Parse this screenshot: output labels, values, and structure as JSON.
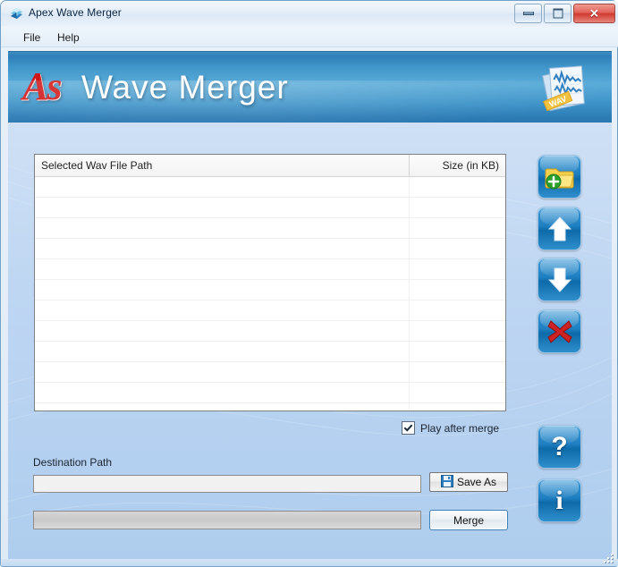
{
  "window": {
    "title": "Apex Wave Merger",
    "app_icon": "app-icon",
    "controls": {
      "minimize": "minimize-button",
      "maximize": "maximize-button",
      "close_label": "✕"
    }
  },
  "menubar": {
    "items": [
      {
        "label": "File"
      },
      {
        "label": "Help"
      }
    ]
  },
  "banner": {
    "logo_text": "As",
    "title": "Wave Merger",
    "icon": "wav-files-icon",
    "colors": {
      "banner_blue": "#3f95c9",
      "logo_red": "#cf1717",
      "title_white": "#ffffff"
    }
  },
  "list": {
    "columns": [
      {
        "label": "Selected Wav File Path",
        "align": "left"
      },
      {
        "label": "Size (in KB)",
        "align": "right"
      }
    ],
    "rows": [],
    "empty_row_count": 11
  },
  "side_buttons": [
    {
      "name": "add-files-button",
      "icon": "folder-add-icon",
      "tooltip": "Add"
    },
    {
      "name": "move-up-button",
      "icon": "arrow-up-icon",
      "tooltip": "Move Up"
    },
    {
      "name": "move-down-button",
      "icon": "arrow-down-icon",
      "tooltip": "Move Down"
    },
    {
      "name": "remove-button",
      "icon": "red-cross-icon",
      "tooltip": "Remove"
    },
    {
      "name": "help-button",
      "icon": "question-mark-icon",
      "glyph": "?",
      "tooltip": "Help"
    },
    {
      "name": "about-button",
      "icon": "info-icon",
      "glyph": "i",
      "tooltip": "About"
    }
  ],
  "options": {
    "play_after_merge": {
      "label": "Play after merge",
      "checked": true
    }
  },
  "destination": {
    "label": "Destination Path",
    "value": "",
    "placeholder": "",
    "save_as_label": "Save As",
    "save_as_icon": "floppy-disk-icon"
  },
  "progress": {
    "value": 0,
    "text": ""
  },
  "actions": {
    "merge_label": "Merge"
  }
}
